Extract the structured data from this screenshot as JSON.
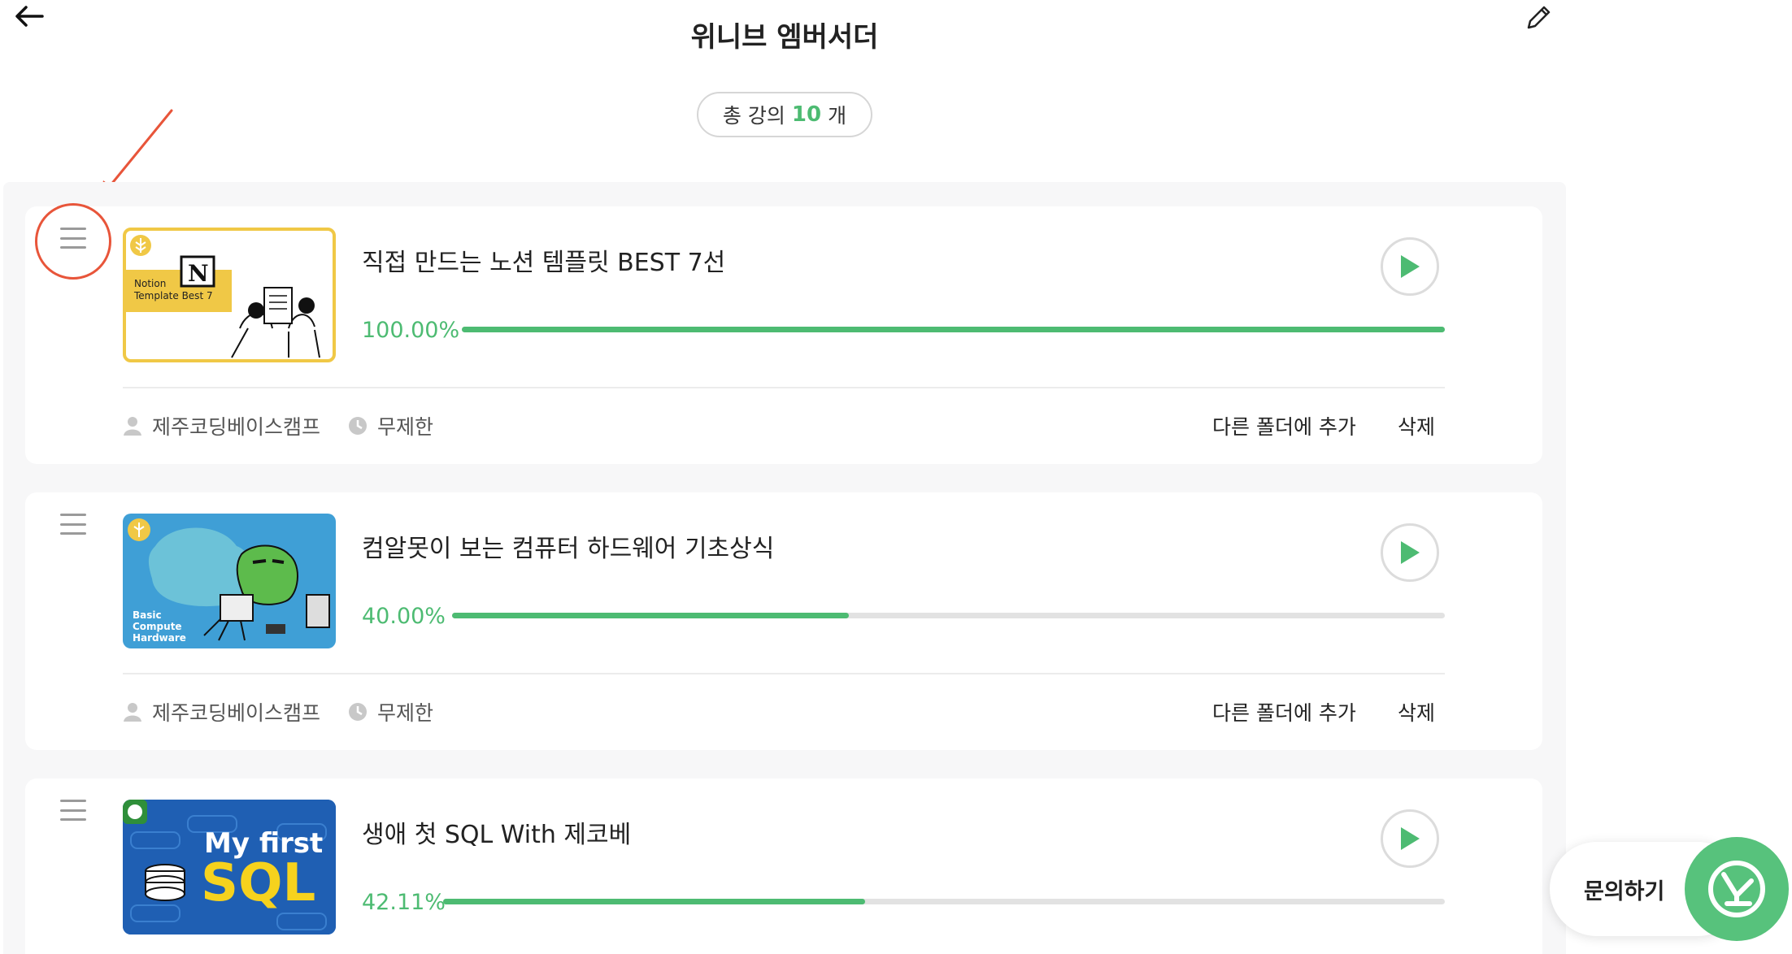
{
  "header": {
    "title": "위니브 엠버서더"
  },
  "summary": {
    "prefix": "총 강의",
    "count": "10",
    "suffix": "개"
  },
  "courses": [
    {
      "title": "직접 만드는 노션 템플릿 BEST 7선",
      "progress_label": "100.00%",
      "progress": 1.0,
      "instructor": "제주코딩베이스캠프",
      "duration": "무제한",
      "thumb_text": [
        "Notion",
        "Template Best 7"
      ],
      "thumb_icon": "notion-n-logo",
      "thumb_color": "#f3c940"
    },
    {
      "title": "컴알못이 보는 컴퓨터 하드웨어 기초상식",
      "progress_label": "40.00%",
      "progress": 0.4,
      "instructor": "제주코딩베이스캠프",
      "duration": "무제한",
      "thumb_text": [
        "Basic",
        "Compute",
        "Hardware"
      ],
      "thumb_color": "#3f9fd6"
    },
    {
      "title": "생애 첫 SQL With 제코베",
      "progress_label": "42.11%",
      "progress": 0.4211,
      "instructor": "",
      "duration": "",
      "thumb_text": [
        "My first",
        "SQL"
      ],
      "thumb_color": "#1f5fb3"
    }
  ],
  "actions": {
    "move_folder": "다른 폴더에 추가",
    "delete": "삭제"
  },
  "chat": {
    "label": "문의하기"
  },
  "colors": {
    "accent": "#4dbb72",
    "annotation": "#e8553a"
  }
}
